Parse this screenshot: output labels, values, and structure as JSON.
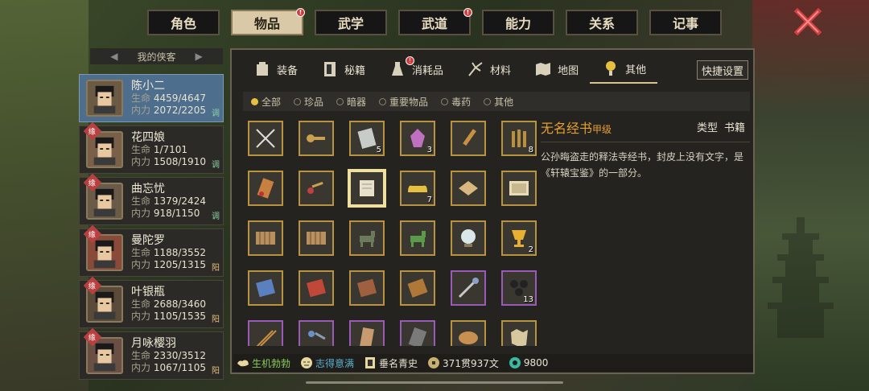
{
  "top_tabs": [
    {
      "label": "角色",
      "active": false,
      "badge": false
    },
    {
      "label": "物品",
      "active": true,
      "badge": true
    },
    {
      "label": "武学",
      "active": false,
      "badge": false
    },
    {
      "label": "武道",
      "active": false,
      "badge": true
    },
    {
      "label": "能力",
      "active": false,
      "badge": false
    },
    {
      "label": "关系",
      "active": false,
      "badge": false
    },
    {
      "label": "记事",
      "active": false,
      "badge": false
    }
  ],
  "roster": {
    "title": "我的侠客",
    "heroes": [
      {
        "name": "陈小二",
        "hp_label": "生命",
        "hp": "4459/4647",
        "mp_label": "内力",
        "mp": "2072/2205",
        "tag": "调",
        "active": true,
        "yuan": false
      },
      {
        "name": "花四娘",
        "hp_label": "生命",
        "hp": "1/7101",
        "mp_label": "内力",
        "mp": "1508/1910",
        "tag": "调",
        "active": false,
        "yuan": true
      },
      {
        "name": "曲忘忧",
        "hp_label": "生命",
        "hp": "1379/2424",
        "mp_label": "内力",
        "mp": "918/1150",
        "tag": "调",
        "active": false,
        "yuan": true
      },
      {
        "name": "曼陀罗",
        "hp_label": "生命",
        "hp": "1188/3552",
        "mp_label": "内力",
        "mp": "1205/1315",
        "tag": "阳",
        "active": false,
        "yuan": true
      },
      {
        "name": "叶银瓶",
        "hp_label": "生命",
        "hp": "2688/3460",
        "mp_label": "内力",
        "mp": "1105/1535",
        "tag": "阳",
        "active": false,
        "yuan": true
      },
      {
        "name": "月咏樱羽",
        "hp_label": "生命",
        "hp": "2330/3512",
        "mp_label": "内力",
        "mp": "1067/1105",
        "tag": "阳",
        "active": false,
        "yuan": true
      }
    ],
    "yuan_label": "缘"
  },
  "sub_tabs": [
    {
      "label": "装备",
      "icon": "armor-icon",
      "active": false,
      "badge": false
    },
    {
      "label": "秘籍",
      "icon": "book-icon",
      "active": false,
      "badge": false
    },
    {
      "label": "消耗品",
      "icon": "potion-icon",
      "active": false,
      "badge": true
    },
    {
      "label": "材料",
      "icon": "herb-icon",
      "active": false,
      "badge": false
    },
    {
      "label": "地图",
      "icon": "map-icon",
      "active": false,
      "badge": false
    },
    {
      "label": "其他",
      "icon": "lamp-icon",
      "active": true,
      "badge": false
    }
  ],
  "quick_settings_label": "快捷设置",
  "filters": [
    {
      "label": "全部",
      "on": true
    },
    {
      "label": "珍品",
      "on": false
    },
    {
      "label": "暗器",
      "on": false
    },
    {
      "label": "重要物品",
      "on": false
    },
    {
      "label": "毒药",
      "on": false
    },
    {
      "label": "其他",
      "on": false
    }
  ],
  "items": [
    {
      "icon": "crossed-needles-icon",
      "count": "",
      "rarity": "gold"
    },
    {
      "icon": "key-icon",
      "count": "",
      "rarity": "gold"
    },
    {
      "icon": "stone-tablet-icon",
      "count": "5",
      "rarity": "gold"
    },
    {
      "icon": "crystal-icon",
      "count": "3",
      "rarity": "gold"
    },
    {
      "icon": "dagger-icon",
      "count": "",
      "rarity": "gold"
    },
    {
      "icon": "bamboo-bundle-icon",
      "count": "8",
      "rarity": "gold"
    },
    {
      "icon": "pouch-icon",
      "count": "",
      "rarity": "gold"
    },
    {
      "icon": "red-key-icon",
      "count": "",
      "rarity": "gold"
    },
    {
      "icon": "scroll-book-icon",
      "count": "",
      "rarity": "gold",
      "selected": true
    },
    {
      "icon": "gold-ingot-icon",
      "count": "7",
      "rarity": "gold"
    },
    {
      "icon": "cloth-icon",
      "count": "",
      "rarity": "gold"
    },
    {
      "icon": "painting-icon",
      "count": "",
      "rarity": "gold"
    },
    {
      "icon": "bamboo-scroll-icon",
      "count": "",
      "rarity": "gold"
    },
    {
      "icon": "bamboo-scroll-icon",
      "count": "",
      "rarity": "gold"
    },
    {
      "icon": "bronze-horse-icon",
      "count": "",
      "rarity": "gold"
    },
    {
      "icon": "jade-horse-icon",
      "count": "",
      "rarity": "gold"
    },
    {
      "icon": "pearl-icon",
      "count": "",
      "rarity": "gold"
    },
    {
      "icon": "golden-cup-icon",
      "count": "2",
      "rarity": "gold"
    },
    {
      "icon": "blue-book-icon",
      "count": "",
      "rarity": "gold"
    },
    {
      "icon": "red-book-icon",
      "count": "",
      "rarity": "gold"
    },
    {
      "icon": "brown-book-icon",
      "count": "",
      "rarity": "gold"
    },
    {
      "icon": "wood-plaque-icon",
      "count": "",
      "rarity": "gold"
    },
    {
      "icon": "fan-icon",
      "count": "",
      "rarity": "purple"
    },
    {
      "icon": "black-pearls-icon",
      "count": "13",
      "rarity": "purple"
    },
    {
      "icon": "arrows-icon",
      "count": "",
      "rarity": "purple"
    },
    {
      "icon": "blue-key-icon",
      "count": "",
      "rarity": "purple"
    },
    {
      "icon": "letter-icon",
      "count": "",
      "rarity": "purple"
    },
    {
      "icon": "token-icon",
      "count": "",
      "rarity": "purple"
    },
    {
      "icon": "bread-icon",
      "count": "",
      "rarity": "gold"
    },
    {
      "icon": "map-piece-icon",
      "count": "",
      "rarity": "gold"
    }
  ],
  "detail": {
    "name": "无名经书",
    "grade": "甲级",
    "type_label": "类型",
    "type_value": "书籍",
    "description": "公孙晦盗走的释法寺经书，封皮上没有文字，是《轩辕宝鉴》的一部分。"
  },
  "status": {
    "vitality": "生机勃勃",
    "mood": "志得意满",
    "fame": "垂名青史",
    "money": "371贯937文",
    "currency": "9800"
  },
  "colors": {
    "gold_border": "#b89440",
    "purple_border": "#9a5ab8",
    "item_name": "#e6a030",
    "active_hero": "#4e6e8e"
  }
}
